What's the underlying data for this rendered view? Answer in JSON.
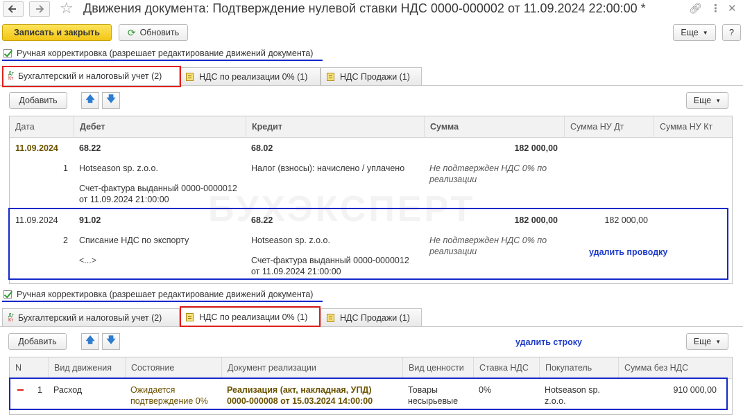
{
  "window": {
    "title": "Движения документа: Подтверждение нулевой ставки НДС 0000-000002 от 11.09.2024 22:00:00 *",
    "icons": {
      "back": "arrow-left-icon",
      "forward": "arrow-right-icon",
      "favorite": "star-icon",
      "link": "link-icon",
      "more": "kebab-icon",
      "close": "close-icon"
    }
  },
  "toolbar": {
    "save_close": "Записать и закрыть",
    "refresh": "Обновить",
    "more": "Еще",
    "help": "?"
  },
  "section1": {
    "manual_label": "Ручная корректировка (разрешает редактирование движений документа)",
    "tabs": [
      {
        "label": "Бухгалтерский и налоговый учет (2)"
      },
      {
        "label": "НДС по реализации 0% (1)"
      },
      {
        "label": "НДС Продажи (1)"
      }
    ],
    "tab_icon_dt": "Дт",
    "tab_icon_kt": "Кт",
    "add": "Добавить",
    "more": "Еще",
    "columns": [
      "Дата",
      "Дебет",
      "Кредит",
      "Сумма",
      "Сумма НУ Дт",
      "Сумма НУ Кт"
    ],
    "rows": [
      {
        "date": "11.09.2024",
        "n": "1",
        "debit_account": "68.22",
        "debit_sub1": "Hotseason sp. z.o.o.",
        "debit_sub2": "Счет-фактура выданный 0000-0000012 от 11.09.2024 21:00:00",
        "credit_account": "68.02",
        "credit_sub1": "Налог (взносы): начислено / уплачено",
        "credit_sub2": "",
        "sum": "182 000,00",
        "sum_note": "Не подтвержден НДС 0% по реализации",
        "nu_dt": "",
        "nu_kt": ""
      },
      {
        "date": "11.09.2024",
        "n": "2",
        "debit_account": "91.02",
        "debit_sub1": "Списание НДС по экспорту",
        "debit_sub2": "<...>",
        "credit_account": "68.22",
        "credit_sub1": "Hotseason sp. z.o.o.",
        "credit_sub2": "Счет-фактура выданный 0000-0000012 от 11.09.2024 21:00:00",
        "sum": "182 000,00",
        "sum_note": "Не подтвержден НДС 0% по реализации",
        "nu_dt": "182 000,00",
        "nu_kt": ""
      }
    ],
    "annotation": "удалить проводку",
    "watermark": "БУХЭКСПЕРТ"
  },
  "section2": {
    "manual_label": "Ручная корректировка (разрешает редактирование движений документа)",
    "tabs": [
      {
        "label": "Бухгалтерский и налоговый учет (2)"
      },
      {
        "label": "НДС по реализации 0% (1)"
      },
      {
        "label": "НДС Продажи (1)"
      }
    ],
    "tab_icon_dt": "Дт",
    "tab_icon_kt": "Кт",
    "add": "Добавить",
    "more": "Еще",
    "annotation": "удалить строку",
    "columns": [
      "N",
      "Вид движения",
      "Состояние",
      "Документ реализации",
      "Вид ценности",
      "Ставка НДС",
      "Покупатель",
      "Сумма без НДС"
    ],
    "rows": [
      {
        "n": "1",
        "movement": "Расход",
        "state": "Ожидается подтверждение 0%",
        "document": "Реализация (акт, накладная, УПД) 0000-000008 от 15.03.2024 14:00:00",
        "value_type": "Товары несырьевые",
        "rate": "0%",
        "buyer": "Hotseason sp. z.o.o.",
        "sum": "910 000,00"
      }
    ]
  }
}
